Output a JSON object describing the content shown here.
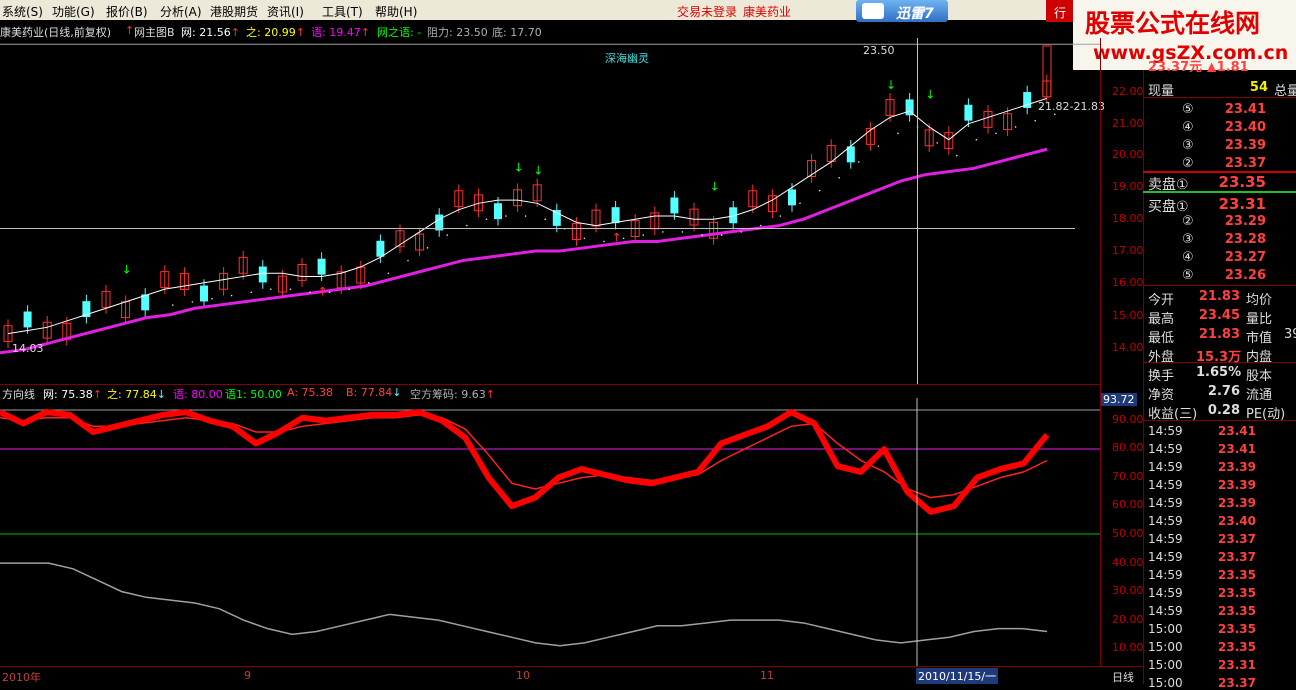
{
  "menu": {
    "items": [
      "系统(S)",
      "功能(G)",
      "报价(B)",
      "分析(A)",
      "港股期货",
      "资讯(I)",
      "工具(T)",
      "帮助(H)"
    ],
    "warning": "交易未登录",
    "stock": "康美药业",
    "xunlei": "迅雷7",
    "hang": "行"
  },
  "watermark": {
    "line1": "股票公式在线网",
    "line2": "www.gsZX.com.cn"
  },
  "header": {
    "title": "康美药业(日线,前复权)",
    "indicator": "网主图B",
    "items": [
      {
        "t": "网: 21.56",
        "arrow": "↑",
        "color": "#ffffff"
      },
      {
        "t": "之: 20.99",
        "arrow": "↑",
        "color": "#ffff00"
      },
      {
        "t": "语: 19.47",
        "arrow": "↑",
        "color": "#ff00ff"
      },
      {
        "t": "网之语: -",
        "arrow": "",
        "color": "#00ff00"
      },
      {
        "t": "阻力: 23.50",
        "arrow": "",
        "color": "#b0b0b0"
      },
      {
        "t": "底: 17.70",
        "arrow": "",
        "color": "#b0b0b0"
      }
    ],
    "label_depth": "深海幽灵"
  },
  "main_chart": {
    "price_axis": [
      "22.00",
      "21.00",
      "20.00",
      "19.00",
      "18.00",
      "17.00",
      "16.00",
      "15.00",
      "14.00"
    ],
    "high_label": "23.50",
    "low_label": "14.03",
    "range_label": "21.82-21.83",
    "ma_white": [
      14.4,
      14.5,
      14.6,
      14.8,
      15.0,
      15.2,
      15.4,
      15.6,
      15.8,
      15.9,
      16.0,
      16.1,
      16.2,
      16.3,
      16.3,
      16.2,
      16.2,
      16.3,
      16.5,
      16.8,
      17.2,
      17.6,
      18.0,
      18.3,
      18.5,
      18.6,
      18.6,
      18.5,
      18.2,
      17.9,
      17.8,
      17.9,
      18.0,
      18.1,
      18.1,
      18.0,
      18.0,
      18.1,
      18.3,
      18.6,
      19.0,
      19.4,
      19.8,
      20.3,
      20.8,
      21.2,
      21.4,
      20.9,
      20.5,
      21.0,
      21.2,
      21.4,
      21.6,
      21.8
    ],
    "ma_magenta": [
      13.8,
      13.9,
      14.1,
      14.3,
      14.5,
      14.7,
      14.9,
      15.0,
      15.2,
      15.3,
      15.4,
      15.5,
      15.6,
      15.7,
      15.8,
      15.9,
      16.1,
      16.3,
      16.5,
      16.7,
      16.8,
      16.9,
      17.0,
      17.0,
      17.1,
      17.2,
      17.3,
      17.3,
      17.4,
      17.5,
      17.6,
      17.7,
      17.8,
      18.0,
      18.3,
      18.6,
      18.9,
      19.2,
      19.4,
      19.5,
      19.6,
      19.8,
      20.0,
      20.2
    ]
  },
  "osc": {
    "title": "方向线",
    "items": [
      {
        "t": "网: 75.38",
        "arrow": "↑",
        "color": "#ffffff"
      },
      {
        "t": "之: 77.84",
        "arrow": "↓",
        "color": "#ffff00"
      },
      {
        "t": "语: 80.00",
        "arrow": "",
        "color": "#ff00ff"
      },
      {
        "t": "语1: 50.00",
        "arrow": "",
        "color": "#00ff00"
      },
      {
        "t": "A: 75.38",
        "arrow": "",
        "color": "#ff4040"
      },
      {
        "t": "B: 77.84",
        "arrow": "↓",
        "color": "#ff4040"
      },
      {
        "t": "空方筹码: 9.63",
        "arrow": "↑",
        "color": "#b0b0b0"
      }
    ],
    "axis": [
      "90.00",
      "80.00",
      "70.00",
      "60.00",
      "50.00",
      "40.00",
      "30.00",
      "20.00",
      "10.00"
    ],
    "cursor_value": "93.72"
  },
  "date_axis": {
    "labels": [
      "2010年",
      "9",
      "10",
      "11"
    ],
    "cursor_date": "2010/11/15/一",
    "period": "日线"
  },
  "quote": {
    "price_line": "23.37元 ▲1.81",
    "now_vol_label": "现量",
    "now_vol": "54",
    "total_vol_label": "总量",
    "sell": [
      {
        "l": "⑤",
        "p": "23.41"
      },
      {
        "l": "④",
        "p": "23.40"
      },
      {
        "l": "③",
        "p": "23.39"
      },
      {
        "l": "②",
        "p": "23.37"
      }
    ],
    "sell1_label": "卖盘①",
    "sell1": "23.35",
    "buy1_label": "买盘①",
    "buy1": "23.31",
    "buy": [
      {
        "l": "②",
        "p": "23.29"
      },
      {
        "l": "③",
        "p": "23.28"
      },
      {
        "l": "④",
        "p": "23.27"
      },
      {
        "l": "⑤",
        "p": "23.26"
      }
    ],
    "stats": [
      {
        "l": "今开",
        "v": "21.83",
        "l2": "均价"
      },
      {
        "l": "最高",
        "v": "23.45",
        "l2": "量比"
      },
      {
        "l": "最低",
        "v": "21.83",
        "l2": "市值",
        "v2": "39"
      },
      {
        "l": "外盘",
        "v": "15.3万",
        "l2": "内盘"
      },
      {
        "l": "换手",
        "v": "1.65%",
        "l2": "股本"
      },
      {
        "l": "净资",
        "v": "2.76",
        "l2": "流通"
      },
      {
        "l": "收益(三)",
        "v": "0.28",
        "l2": "PE(动)"
      }
    ],
    "ticks": [
      {
        "t": "14:59",
        "p": "23.41"
      },
      {
        "t": "14:59",
        "p": "23.41"
      },
      {
        "t": "14:59",
        "p": "23.39"
      },
      {
        "t": "14:59",
        "p": "23.39"
      },
      {
        "t": "14:59",
        "p": "23.39"
      },
      {
        "t": "14:59",
        "p": "23.40"
      },
      {
        "t": "14:59",
        "p": "23.37"
      },
      {
        "t": "14:59",
        "p": "23.37"
      },
      {
        "t": "14:59",
        "p": "23.35"
      },
      {
        "t": "14:59",
        "p": "23.35"
      },
      {
        "t": "14:59",
        "p": "23.35"
      },
      {
        "t": "15:00",
        "p": "23.35"
      },
      {
        "t": "15:00",
        "p": "23.35"
      },
      {
        "t": "15:00",
        "p": "23.31"
      },
      {
        "t": "15:00",
        "p": "23.37"
      }
    ]
  },
  "colors": {
    "up": "#ff3030",
    "down": "#54ffff",
    "ma": "#ffffff",
    "ma2": "#e020e0",
    "grid": "#800000"
  }
}
